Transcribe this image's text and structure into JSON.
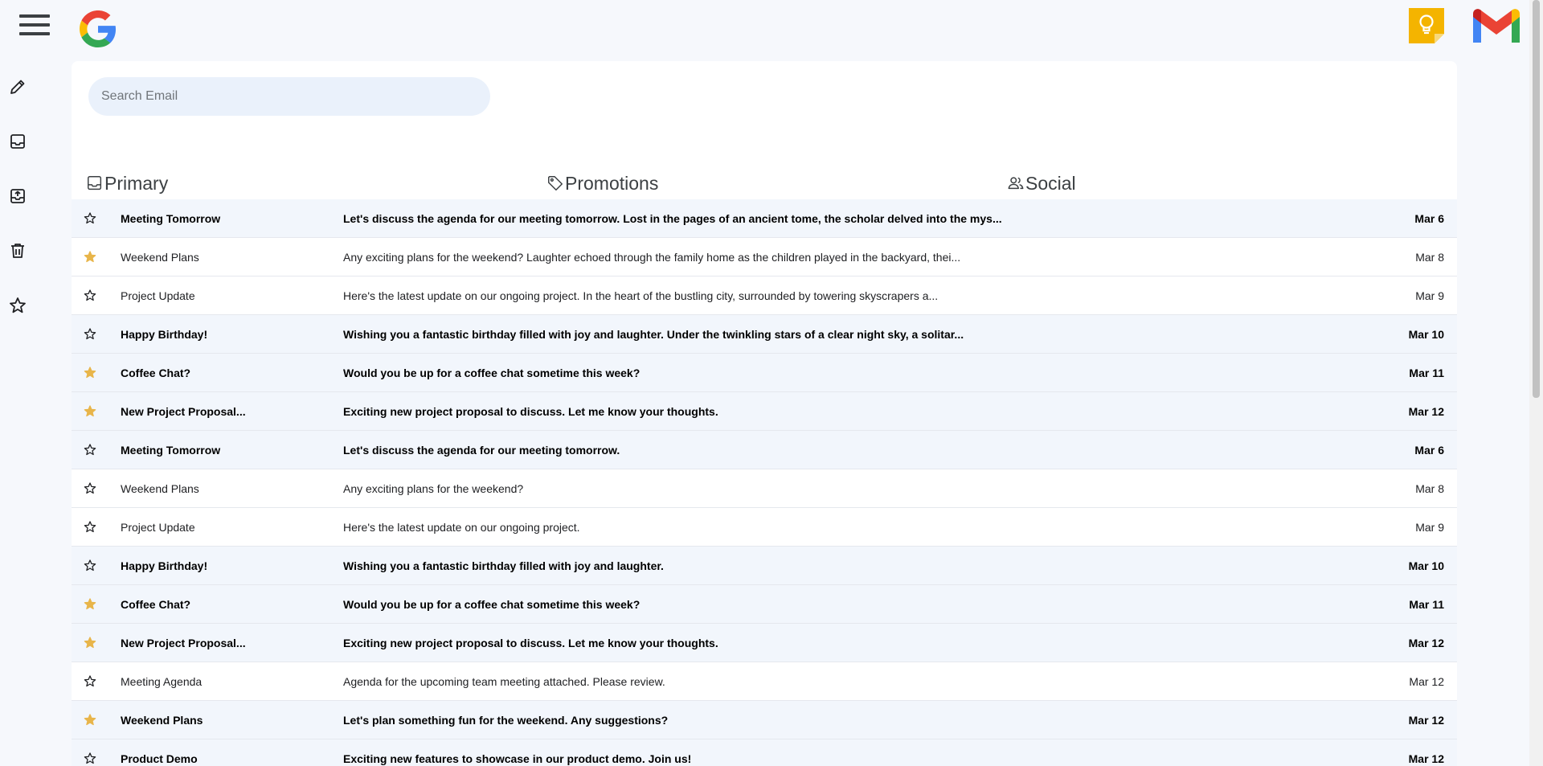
{
  "search": {
    "placeholder": "Search Email"
  },
  "tabs": [
    {
      "label": "Primary",
      "icon": "inbox-icon"
    },
    {
      "label": "Promotions",
      "icon": "tag-icon"
    },
    {
      "label": "Social",
      "icon": "people-icon"
    }
  ],
  "sidenav": [
    "pencil-icon",
    "inbox-icon",
    "archive-icon",
    "trash-icon",
    "star-icon"
  ],
  "colors": {
    "star_filled": "#e8b54a",
    "unread_bg": "#f2f6fc",
    "keep_yellow": "#f4b400"
  },
  "emails": [
    {
      "sender": "Meeting Tomorrow",
      "snippet": "Let's discuss the agenda for our meeting tomorrow. Lost in the pages of an ancient tome, the scholar delved into the mys...",
      "date": "Mar 6",
      "unread": true,
      "starred": false
    },
    {
      "sender": "Weekend Plans",
      "snippet": "Any exciting plans for the weekend? Laughter echoed through the family home as the children played in the backyard, thei...",
      "date": "Mar 8",
      "unread": false,
      "starred": true
    },
    {
      "sender": "Project Update",
      "snippet": "Here's the latest update on our ongoing project. In the heart of the bustling city, surrounded by towering skyscrapers a...",
      "date": "Mar 9",
      "unread": false,
      "starred": false
    },
    {
      "sender": "Happy Birthday!",
      "snippet": "Wishing you a fantastic birthday filled with joy and laughter. Under the twinkling stars of a clear night sky, a solitar...",
      "date": "Mar 10",
      "unread": true,
      "starred": false
    },
    {
      "sender": "Coffee Chat?",
      "snippet": "Would you be up for a coffee chat sometime this week?",
      "date": "Mar 11",
      "unread": true,
      "starred": true
    },
    {
      "sender": "New Project Proposal...",
      "snippet": "Exciting new project proposal to discuss. Let me know your thoughts.",
      "date": "Mar 12",
      "unread": true,
      "starred": true
    },
    {
      "sender": "Meeting Tomorrow",
      "snippet": "Let's discuss the agenda for our meeting tomorrow.",
      "date": "Mar 6",
      "unread": true,
      "starred": false
    },
    {
      "sender": "Weekend Plans",
      "snippet": "Any exciting plans for the weekend?",
      "date": "Mar 8",
      "unread": false,
      "starred": false
    },
    {
      "sender": "Project Update",
      "snippet": "Here's the latest update on our ongoing project.",
      "date": "Mar 9",
      "unread": false,
      "starred": false
    },
    {
      "sender": "Happy Birthday!",
      "snippet": "Wishing you a fantastic birthday filled with joy and laughter.",
      "date": "Mar 10",
      "unread": true,
      "starred": false
    },
    {
      "sender": "Coffee Chat?",
      "snippet": "Would you be up for a coffee chat sometime this week?",
      "date": "Mar 11",
      "unread": true,
      "starred": true
    },
    {
      "sender": "New Project Proposal...",
      "snippet": "Exciting new project proposal to discuss. Let me know your thoughts.",
      "date": "Mar 12",
      "unread": true,
      "starred": true
    },
    {
      "sender": "Meeting Agenda",
      "snippet": "Agenda for the upcoming team meeting attached. Please review.",
      "date": "Mar 12",
      "unread": false,
      "starred": false
    },
    {
      "sender": "Weekend Plans",
      "snippet": "Let's plan something fun for the weekend. Any suggestions?",
      "date": "Mar 12",
      "unread": true,
      "starred": true
    },
    {
      "sender": "Product Demo",
      "snippet": "Exciting new features to showcase in our product demo. Join us!",
      "date": "Mar 12",
      "unread": true,
      "starred": false
    }
  ]
}
